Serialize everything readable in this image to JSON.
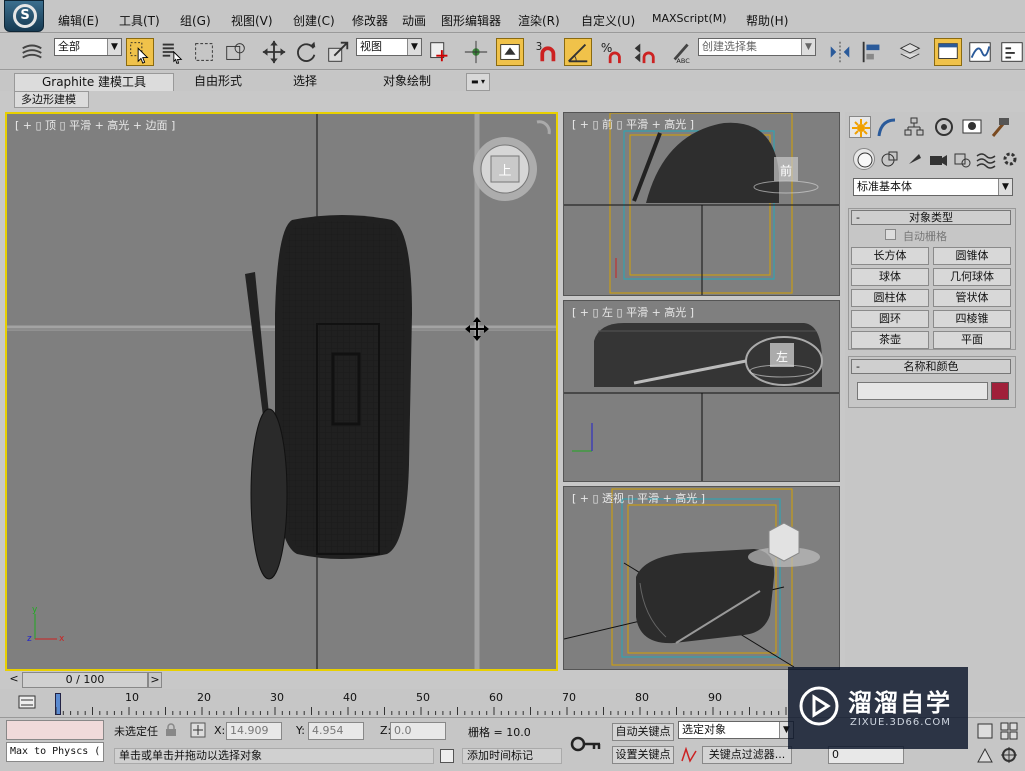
{
  "menubar": {
    "items": [
      "编辑(E)",
      "工具(T)",
      "组(G)",
      "视图(V)",
      "创建(C)",
      "修改器",
      "动画",
      "图形编辑器",
      "渲染(R)",
      "自定义(U)",
      "MAXScript(M)",
      "帮助(H)"
    ]
  },
  "toolbar": {
    "selection_filter": "全部",
    "ref_coord": "视图",
    "named_selection_placeholder": "创建选择集",
    "snap_label": "3"
  },
  "ribbon": {
    "tabs": [
      "Graphite 建模工具",
      "自由形式",
      "选择",
      "对象绘制"
    ],
    "subtab": "多边形建模"
  },
  "viewports": {
    "top": {
      "label": "[ + ▯ 顶 ▯ 平滑 + 高光 + 边面 ]",
      "cube_face": "上"
    },
    "front": {
      "label": "[ + ▯ 前 ▯ 平滑 + 高光 ]",
      "cube_face": "前"
    },
    "left": {
      "label": "[ + ▯ 左 ▯ 平滑 + 高光 ]",
      "cube_face": "左"
    },
    "persp": {
      "label": "[ + ▯ 透视 ▯ 平滑 + 高光 ]"
    }
  },
  "command_panel": {
    "category": "标准基本体",
    "object_type_title": "对象类型",
    "autogrid": "自动栅格",
    "objects": [
      "长方体",
      "圆锥体",
      "球体",
      "几何球体",
      "圆柱体",
      "管状体",
      "圆环",
      "四棱锥",
      "茶壶",
      "平面"
    ],
    "name_color_title": "名称和颜色",
    "object_color": "#a0203a"
  },
  "timeline": {
    "slider": "0 / 100",
    "ticks": [
      "10",
      "20",
      "30",
      "40",
      "50",
      "60",
      "70",
      "80",
      "90"
    ]
  },
  "status": {
    "script_listener": "Max to Physcs (",
    "selection": "未选定任",
    "x_label": "X:",
    "x": "14.909",
    "y_label": "Y:",
    "y": "4.954",
    "z_label": "Z:",
    "z": "0.0",
    "grid": "栅格 = 10.0",
    "auto_key": "自动关键点",
    "set_key": "设置关键点",
    "selected_object": "选定对象",
    "key_filter": "关键点过滤器...",
    "prompt": "单击或单击并拖动以选择对象",
    "add_time_tag": "添加时间标记",
    "frame": "0"
  },
  "watermark": {
    "title": "溜溜自学",
    "url": "ZIXUE.3D66.COM"
  }
}
